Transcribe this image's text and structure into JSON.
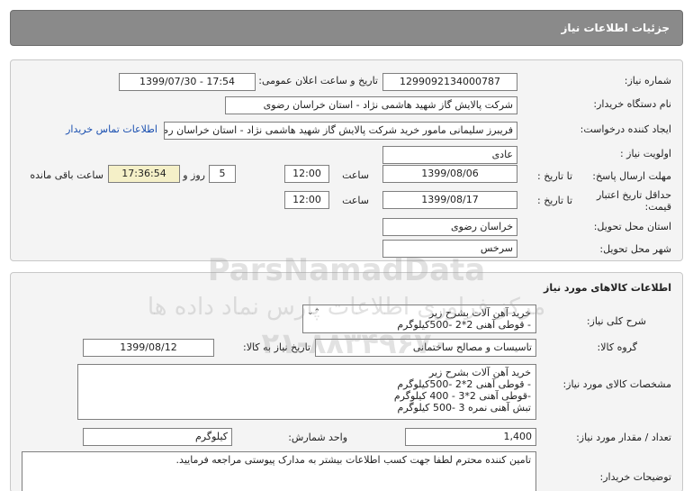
{
  "header": {
    "title": "جزئیات اطلاعات نیاز"
  },
  "need": {
    "number_label": "شماره نیاز:",
    "number": "1299092134000787",
    "announce_label": "تاریخ و ساعت اعلان عمومی:",
    "announce_value": "1399/07/30 - 17:54",
    "buyer_label": "نام دستگاه خریدار:",
    "buyer": "شرکت پالایش گاز شهید هاشمی نژاد - استان خراسان رضوی",
    "creator_label": "ایجاد کننده درخواست:",
    "creator": "فریبرز سلیمانی مامور خرید شرکت پالایش گاز شهید هاشمی نژاد - استان خراسان رضوی",
    "contact_link": "اطلاعات تماس خریدار",
    "priority_label": "اولویت نیاز :",
    "priority": "عادی",
    "deadline_label": "مهلت ارسال پاسخ:",
    "until_date_label": "تا تاریخ :",
    "deadline_date": "1399/08/06",
    "hour_label": "ساعت",
    "deadline_time": "12:00",
    "days": "5",
    "days_label": "روز و",
    "remaining_time": "17:36:54",
    "remaining_label": "ساعت باقی مانده",
    "validity_label_1": "حداقل تاریخ اعتبار",
    "validity_label_2": "قیمت:",
    "validity_date": "1399/08/17",
    "validity_time": "12:00",
    "province_label": "استان محل تحویل:",
    "province": "خراسان رضوی",
    "city_label": "شهر محل تحویل:",
    "city": "سرخس"
  },
  "goods": {
    "section_title": "اطلاعات کالاهای مورد نیاز",
    "summary_label": "شرح کلی نیاز:",
    "summary_lines": [
      "خرید آهن آلات بشرح زیر",
      "- قوطی آهنی 2*2 -500کیلوگرم"
    ],
    "group_label": "گروه کالا:",
    "group": "تاسیسات و مصالح ساختمانی",
    "need_date_label": "تاریخ نیاز به کالا:",
    "need_date": "1399/08/12",
    "spec_label": "مشخصات کالای مورد نیاز:",
    "spec_lines": [
      "خرید آهن آلات بشرح زیر",
      "- قوطی آهنی 2*2 -500کیلوگرم",
      "-قوطی آهنی 2*3 - 400 کیلوگرم",
      "تبش آهنی نمره 3 -500 کیلوگرم"
    ],
    "qty_label": "تعداد / مقدار مورد نیاز:",
    "qty": "1,400",
    "unit_label": "واحد شمارش:",
    "unit": "کیلوگرم",
    "notes_label": "توضیحات خریدار:",
    "notes": "تامین کننده محترم لطفا جهت کسب اطلاعات بیشتر به مدارک پیوستی مراجعه فرمایید."
  },
  "watermark": {
    "line1": "ParsNamadData",
    "line2": "مرکز فراوری اطلاعات پارس نماد داده ها",
    "line3": "۰۲۱-۸۸۳۴۹۶۷۰"
  }
}
